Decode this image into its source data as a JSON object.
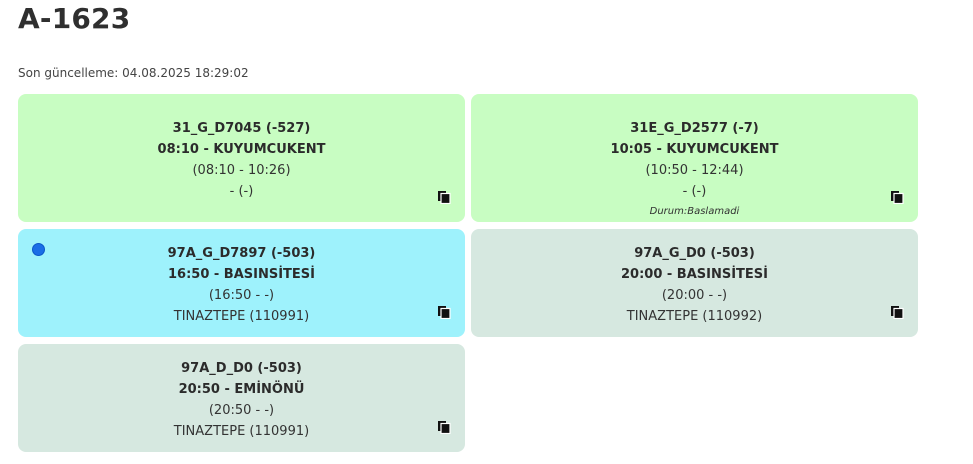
{
  "page": {
    "title": "A-1623",
    "last_updated": "Son güncelleme: 04.08.2025 18:29:02"
  },
  "cards": [
    {
      "line1": "31_G_D7045 (-527)",
      "line2": "08:10 - KUYUMCUKENT",
      "line3": "(08:10 - 10:26)",
      "line4": "- (-)",
      "status": ""
    },
    {
      "line1": "31E_G_D2577 (-7)",
      "line2": "10:05 - KUYUMCUKENT",
      "line3": "(10:50 - 12:44)",
      "line4": "- (-)",
      "status": "Durum:Baslamadi"
    },
    {
      "line1": "97A_G_D7897 (-503)",
      "line2": "16:50 - BASINSİTESİ",
      "line3": "(16:50 - -)",
      "line4": "TINAZTEPE (110991)",
      "status": ""
    },
    {
      "line1": "97A_G_D0 (-503)",
      "line2": "20:00 - BASINSİTESİ",
      "line3": "(20:00 - -)",
      "line4": "TINAZTEPE (110992)",
      "status": ""
    },
    {
      "line1": "97A_D_D0 (-503)",
      "line2": "20:50 - EMİNÖNÜ",
      "line3": "(20:50 - -)",
      "line4": "TINAZTEPE (110991)",
      "status": ""
    }
  ],
  "colors": {
    "completed": "#c8fdc2",
    "active": "#9ef2fc",
    "pending": "#d6e8e0",
    "active_dot": "#1a6ee6"
  },
  "icons": {
    "copy": "copy-icon",
    "active_indicator": "active-dot"
  }
}
